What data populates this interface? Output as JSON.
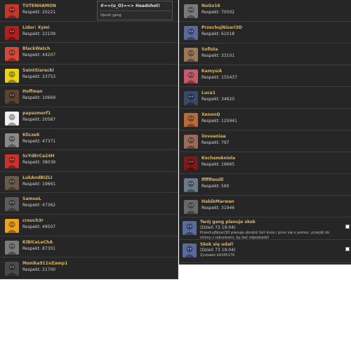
{
  "respect_label": "Respekt:",
  "gang": {
    "title": "#==(o_O)==> Headshot!",
    "leave": "Opuść gang"
  },
  "left_players": [
    {
      "name": "TUTENHAMON",
      "respect": "20221",
      "color": "#c0392b",
      "icon": "red-face-icon"
    },
    {
      "name": "Lidor: Xymi",
      "respect": "22109",
      "color": "#b02020",
      "icon": "red-cross-icon"
    },
    {
      "name": "BlackWatch",
      "respect": "44207",
      "color": "#d24a3a",
      "icon": "figure-icon"
    },
    {
      "name": "SaintSiarecki",
      "respect": "23753",
      "color": "#e8d21c",
      "icon": "smiley-icon"
    },
    {
      "name": "Hoffman",
      "respect": "10669",
      "color": "#5a4434",
      "icon": "dark-figure-icon"
    },
    {
      "name": "papasmerf1",
      "respect": "20587",
      "color": "#f0f0f0",
      "icon": "cartoon-icon"
    },
    {
      "name": "KliczeK",
      "respect": "47371",
      "color": "#8a8a8a",
      "icon": "skull-icon"
    },
    {
      "name": "ScYdErCa24H",
      "respect": "38039",
      "color": "#c8342a",
      "icon": "eagle-icon"
    },
    {
      "name": "LukAndBIZLI",
      "respect": "19661",
      "color": "#6a5a4a",
      "icon": "face-icon"
    },
    {
      "name": "SamueL",
      "respect": "47362",
      "color": "#5c5c5c",
      "icon": "man-icon"
    },
    {
      "name": "crouch3r",
      "respect": "49507",
      "color": "#f0a020",
      "icon": "cartoon-icon"
    },
    {
      "name": "KiBiCeLeChA",
      "respect": "87301",
      "color": "#7a7a7a",
      "icon": "skull-icon"
    },
    {
      "name": "Monika911nZamp1",
      "respect": "21700",
      "color": "#4a4a4a",
      "icon": "skull-icon"
    }
  ],
  "right_players": [
    {
      "name": "NuGo16",
      "respect": "70502",
      "color": "#7a7a7a",
      "icon": "mask-icon"
    },
    {
      "name": "PrzechujNizari3D",
      "respect": "61018",
      "color": "#5a6a9a",
      "icon": "assassin-icon"
    },
    {
      "name": "Sofista",
      "respect": "33101",
      "color": "#9a7a5a",
      "icon": "face-icon"
    },
    {
      "name": "KamysiA",
      "respect": "155437",
      "color": "#c85a6a",
      "icon": "figure-icon"
    },
    {
      "name": "Luca1",
      "respect": "34920",
      "color": "#3a4a6a",
      "icon": "dark-figure-icon"
    },
    {
      "name": "XenonQ",
      "respect": "125941",
      "color": "#b86a3a",
      "icon": "face-icon"
    },
    {
      "name": "iloveaniaa",
      "respect": "797",
      "color": "#9a6a5a",
      "icon": "woman-icon"
    },
    {
      "name": "KochamAniola",
      "respect": "16665",
      "color": "#7a1a1a",
      "icon": "signature-icon"
    },
    {
      "name": "ffffffmnlll",
      "respect": "560",
      "color": "#6a7a8a",
      "icon": "alien-icon"
    },
    {
      "name": "HabibMarwan",
      "respect": "31946",
      "color": "#6a6a6a",
      "icon": "man-icon"
    }
  ],
  "notifications": [
    {
      "title": "Twój gang planuje skok",
      "date": "(Dzień 73 19:04)",
      "body": "PrzechujNizari3D planuje obrobić fort knox i prosi się o pomoc, przejdź do strony z rabunkami, by dać odpowiedź!",
      "color": "#5a6a9a",
      "icon": "assassin-icon"
    },
    {
      "title": "Skok się udał!",
      "date": "(Dzień 73 19:04)",
      "body": "Zyskałeś $4345176.",
      "color": "#5a6a9a",
      "icon": "assassin-icon"
    }
  ]
}
